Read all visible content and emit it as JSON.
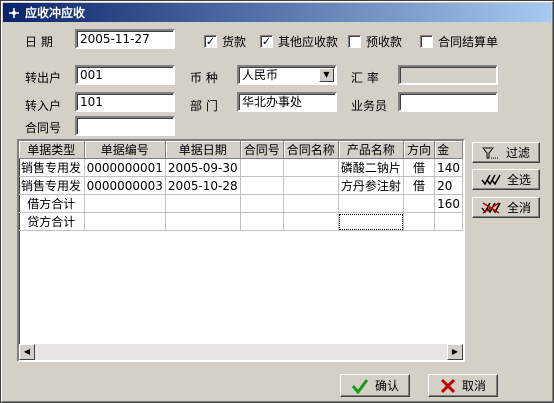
{
  "window": {
    "title": "应收冲应收"
  },
  "filters": {
    "date_label": "日  期",
    "date_value": "2005-11-27",
    "checks": [
      {
        "label": "货款",
        "checked": true
      },
      {
        "label": "其他应收款",
        "checked": true
      },
      {
        "label": "预收款",
        "checked": false
      },
      {
        "label": "合同结算单",
        "checked": false
      }
    ]
  },
  "form": {
    "from_account_label": "转出户",
    "from_account_value": "001",
    "currency_label": "币  种",
    "currency_value": "人民币",
    "rate_label": "汇  率",
    "rate_value": "",
    "to_account_label": "转入户",
    "to_account_value": "101",
    "dept_label": "部  门",
    "dept_value": "华北办事处",
    "salesman_label": "业务员",
    "salesman_value": "",
    "contract_label": "合同号",
    "contract_value": ""
  },
  "grid": {
    "columns": [
      "单据类型",
      "单据编号",
      "单据日期",
      "合同号",
      "合同名称",
      "产品名称",
      "方向",
      "金"
    ],
    "rows": [
      [
        "销售专用发",
        "0000000001",
        "2005-09-30",
        "",
        "",
        "磷酸二钠片",
        "借",
        "140"
      ],
      [
        "销售专用发",
        "0000000003",
        "2005-10-28",
        "",
        "",
        "方丹参注射",
        "借",
        "20"
      ],
      [
        "借方合计",
        "",
        "",
        "",
        "",
        "",
        "",
        "160"
      ],
      [
        "贷方合计",
        "",
        "",
        "",
        "",
        "",
        "",
        ""
      ]
    ]
  },
  "side_buttons": {
    "filter": "过滤",
    "select_all": "全选",
    "clear_all": "全消"
  },
  "footer": {
    "ok": "确认",
    "cancel": "取消"
  },
  "colors": {
    "title_start": "#0a246a",
    "title_end": "#a6caf0",
    "ok_check": "#1a9a1a",
    "cancel_x": "#c00000"
  }
}
